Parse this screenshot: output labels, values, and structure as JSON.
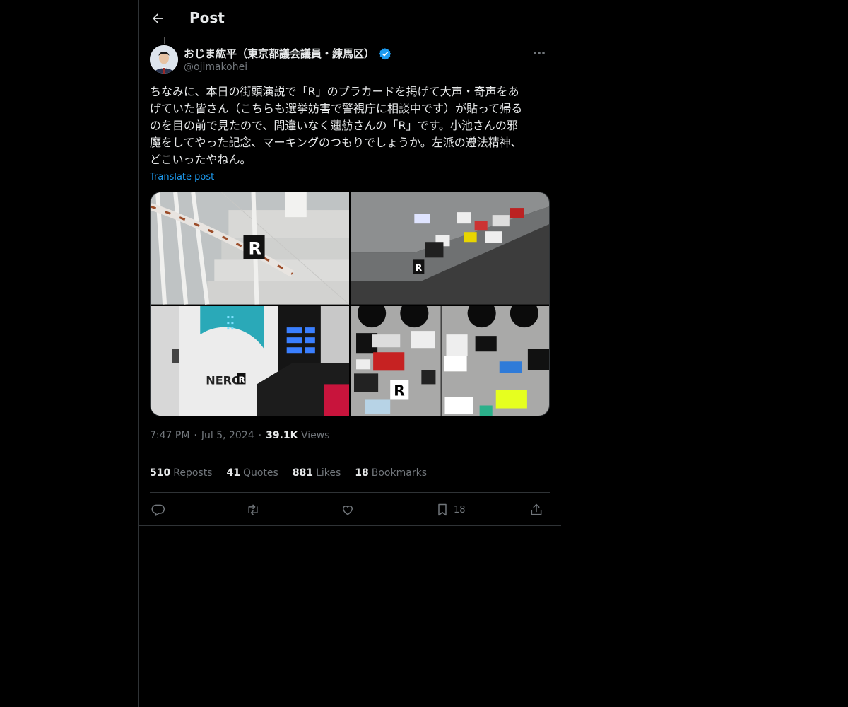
{
  "header": {
    "title": "Post",
    "back_icon": "arrow-left-icon"
  },
  "author": {
    "display_name": "おじま紘平（東京都議会議員・練馬区）",
    "handle": "@ojimakohei",
    "verified": true,
    "verified_color": "#1d9bf0"
  },
  "post": {
    "text": "ちなみに、本日の街頭演説で「R」のプラカードを掲げて大声・奇声をあ\nげていた皆さん（こちらも選挙妨害で警視庁に相談中です）が貼って帰る\nのを目の前で見たので、間違いなく蓮舫さんの「R」です。小池さんの邪\n魔をしてやった記念、マーキングのつもりでしょうか。左派の遵法精神、\nどこいったやねん。",
    "translate_label": "Translate post",
    "images": [
      "railing-sticker-photo",
      "curb-stickers-photo",
      "vending-machine-photo",
      "wall-stickers-photo"
    ]
  },
  "meta": {
    "time": "7:47 PM",
    "date": "Jul 5, 2024",
    "views_count": "39.1K",
    "views_label": "Views",
    "separator": "·"
  },
  "stats": [
    {
      "count": "510",
      "label": "Reposts"
    },
    {
      "count": "41",
      "label": "Quotes"
    },
    {
      "count": "881",
      "label": "Likes"
    },
    {
      "count": "18",
      "label": "Bookmarks"
    }
  ],
  "actions": {
    "reply_icon": "reply-icon",
    "repost_icon": "repost-icon",
    "like_icon": "heart-icon",
    "bookmark_icon": "bookmark-icon",
    "bookmark_count": "18",
    "share_icon": "share-icon"
  },
  "colors": {
    "background": "#000000",
    "accent": "#1d9bf0",
    "muted": "#71767b",
    "border": "#2f3336"
  }
}
